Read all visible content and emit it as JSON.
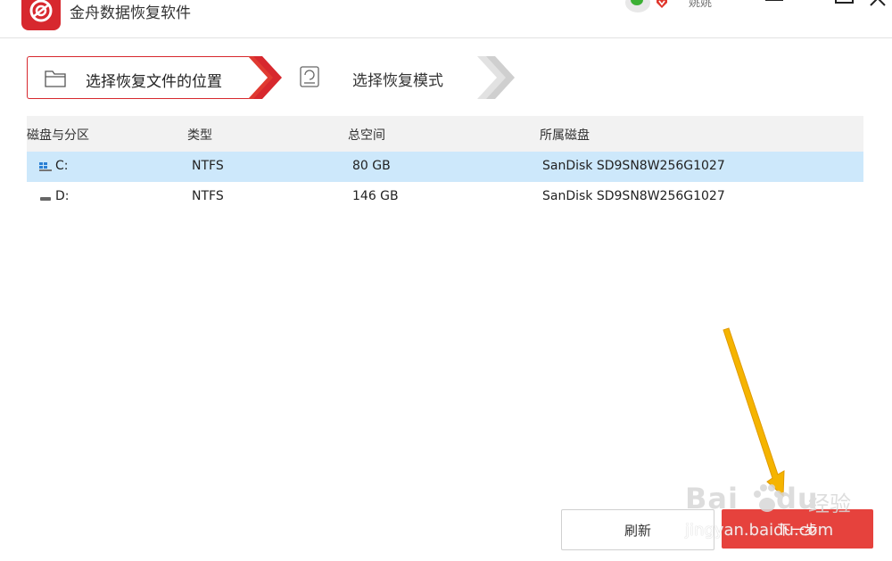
{
  "window": {
    "title": "金舟数据恢复软件",
    "user_name": "姚姚",
    "brand_color": "#d7282e"
  },
  "steps": [
    {
      "label": "选择恢复文件的位置",
      "icon": "folder-icon",
      "state": "active"
    },
    {
      "label": "选择恢复模式",
      "icon": "disk-mode-icon",
      "state": "inactive"
    }
  ],
  "table": {
    "headers": [
      "磁盘与分区",
      "类型",
      "总空间",
      "所属磁盘"
    ],
    "rows": [
      {
        "name": "C:",
        "type": "NTFS",
        "size": "80 GB",
        "disk": "SanDisk SD9SN8W256G1027",
        "selected": true,
        "icon": "windows-drive-icon"
      },
      {
        "name": "D:",
        "type": "NTFS",
        "size": "146 GB",
        "disk": "SanDisk SD9SN8W256G1027",
        "selected": false,
        "icon": "drive-icon"
      }
    ]
  },
  "buttons": {
    "refresh": "刷新",
    "next": "下一步"
  },
  "watermark": {
    "brand": "Bai",
    "brand2": "du",
    "jingyan": "经验",
    "url": "jingyan.baidu.com"
  },
  "colors": {
    "accent": "#d7282e",
    "next_button": "#e6423d",
    "selected_row": "#cde8fb",
    "header_bg": "#f2f2f2",
    "annotation_arrow": "#f5b400"
  }
}
